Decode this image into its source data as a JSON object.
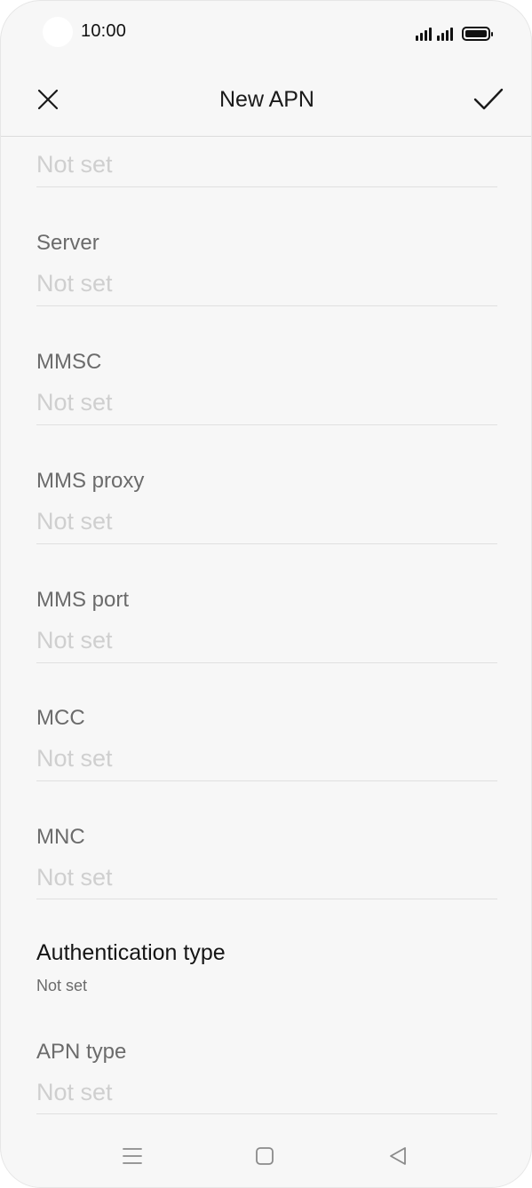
{
  "status_bar": {
    "time": "10:00",
    "signal_icons": [
      "signal-icon",
      "signal-icon"
    ],
    "battery_icon": "battery-icon",
    "battery_level": 1.0
  },
  "app_bar": {
    "close_icon": "close-icon",
    "title": "New APN",
    "confirm_icon": "checkmark-icon"
  },
  "fields": {
    "partial_top": {
      "value": "Not set"
    },
    "server": {
      "label": "Server",
      "value": "Not set"
    },
    "mmsc": {
      "label": "MMSC",
      "value": "Not set"
    },
    "mms_proxy": {
      "label": "MMS proxy",
      "value": "Not set"
    },
    "mms_port": {
      "label": "MMS port",
      "value": "Not set"
    },
    "mcc": {
      "label": "MCC",
      "value": "Not set"
    },
    "mnc": {
      "label": "MNC",
      "value": "Not set"
    },
    "authentication_type": {
      "label": "Authentication type",
      "value": "Not set"
    },
    "apn_type": {
      "label": "APN type",
      "value": "Not set"
    }
  },
  "nav_bar": {
    "menu_icon": "menu-icon",
    "home_icon": "home-icon",
    "back_icon": "back-icon"
  },
  "colors": {
    "background": "#f7f7f7",
    "label": "#6b6b6b",
    "placeholder": "#cfcfcf",
    "divider": "#e0e0e0",
    "text_primary": "#1a1a1a"
  }
}
